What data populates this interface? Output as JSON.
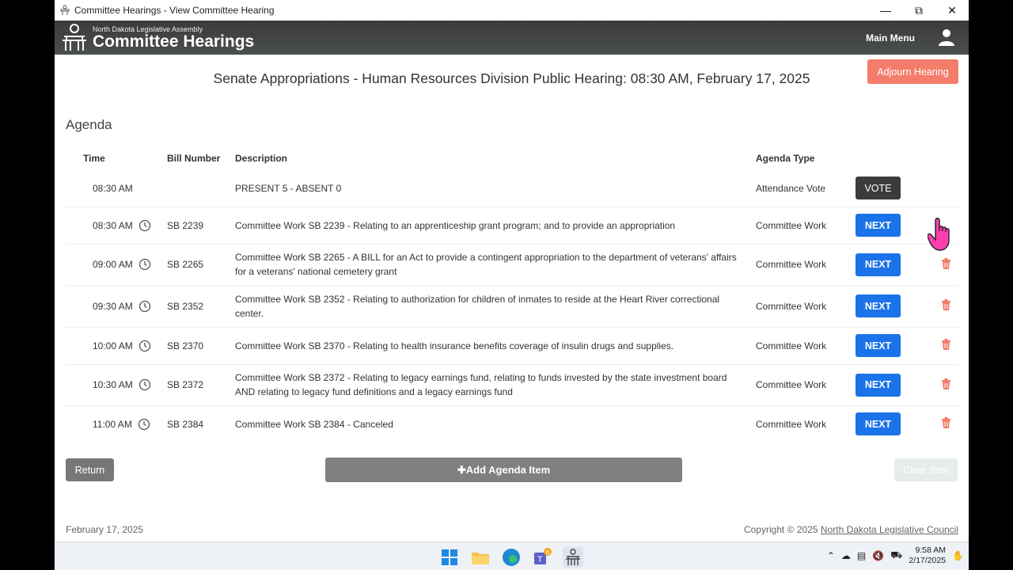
{
  "window": {
    "title": "Committee Hearings - View Committee Hearing"
  },
  "header": {
    "subtitle": "North Dakota Legislative Assembly",
    "title": "Committee Hearings",
    "main_menu": "Main Menu"
  },
  "hearing_title": "Senate Appropriations - Human Resources Division Public Hearing: 08:30 AM, February 17, 2025",
  "agenda": {
    "label": "Agenda",
    "adjourn_label": "Adjourn Hearing",
    "columns": {
      "time": "Time",
      "bill": "Bill Number",
      "desc": "Description",
      "type": "Agenda Type"
    },
    "rows": [
      {
        "time": "08:30 AM",
        "bill": "",
        "desc": "PRESENT 5 - ABSENT 0",
        "type": "Attendance Vote",
        "action": "VOTE"
      },
      {
        "time": "08:30 AM",
        "bill": "SB 2239",
        "desc": "Committee Work SB 2239 - Relating to an apprenticeship grant program; and to provide an appropriation",
        "type": "Committee Work",
        "action": "NEXT"
      },
      {
        "time": "09:00 AM",
        "bill": "SB 2265",
        "desc": "Committee Work SB 2265 - A BILL for an Act to provide a contingent appropriation to the department of veterans' affairs for a veterans' national cemetery grant",
        "type": "Committee Work",
        "action": "NEXT"
      },
      {
        "time": "09:30 AM",
        "bill": "SB 2352",
        "desc": "Committee Work SB 2352 - Relating to authorization for children of inmates to reside at the Heart River correctional center.",
        "type": "Committee Work",
        "action": "NEXT"
      },
      {
        "time": "10:00 AM",
        "bill": "SB 2370",
        "desc": "Committee Work SB 2370 - Relating to health insurance benefits coverage of insulin drugs and supplies.",
        "type": "Committee Work",
        "action": "NEXT"
      },
      {
        "time": "10:30 AM",
        "bill": "SB 2372",
        "desc": "Committee Work SB 2372 - Relating to legacy earnings fund, relating to funds invested by the state investment board AND relating to legacy fund definitions and a legacy earnings fund",
        "type": "Committee Work",
        "action": "NEXT"
      },
      {
        "time": "11:00 AM",
        "bill": "SB 2384",
        "desc": "Committee Work SB 2384 - Canceled",
        "type": "Committee Work",
        "action": "NEXT"
      }
    ]
  },
  "buttons": {
    "return": "Return",
    "add_item": "Add Agenda Item",
    "clear_item": "Clear Item"
  },
  "footer": {
    "date": "February 17, 2025",
    "copyright": "Copyright © 2025",
    "council": "North Dakota Legislative Council"
  },
  "taskbar": {
    "time": "9:58 AM",
    "date": "2/17/2025",
    "teams_badge": "6"
  },
  "icons": {
    "app": "podium-icon",
    "user": "user-icon",
    "clock": "clock-icon",
    "delete": "trash-icon",
    "cursor": "hand-pointer-icon"
  },
  "colors": {
    "header_bg": "#444846",
    "next": "#1a73e8",
    "vote": "#3b3b3b",
    "adjourn": "#f47c6b",
    "trash": "#f47c6b"
  }
}
